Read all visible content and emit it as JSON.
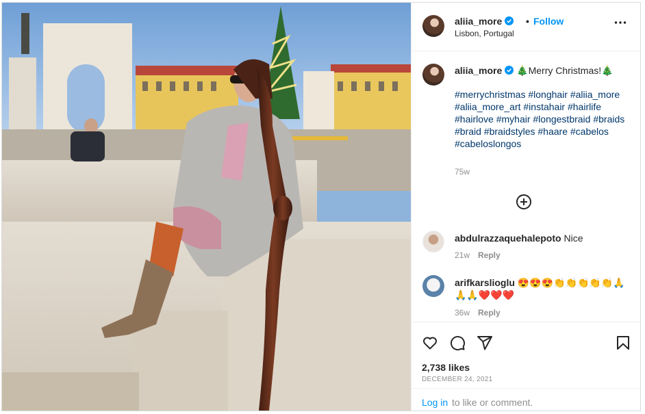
{
  "header": {
    "username": "aliia_more",
    "dot": "•",
    "follow_label": "Follow",
    "location": "Lisbon, Portugal"
  },
  "caption": {
    "username": "aliia_more",
    "text": "🎄Merry Christmas!🎄",
    "hashtags": "#merrychristmas #longhair #aliia_more #aliia_more_art #instahair #hairlife #hairlove #myhair #longestbraid #braids #braid #braidstyles #haare #cabelos #cabeloslongos",
    "time": "75w"
  },
  "comments": [
    {
      "username": "abdulrazzaquehalepoto",
      "text": "Nice",
      "time": "21w",
      "reply_label": "Reply"
    },
    {
      "username": "arifkarslioglu",
      "text": "😍😍😍👏👏👏👏👏🙏🙏🙏❤️❤️❤️",
      "time": "36w",
      "reply_label": "Reply"
    }
  ],
  "actions": {
    "likes": "2,738 likes",
    "date": "DECEMBER 24, 2021",
    "login_link": "Log in",
    "login_rest": "to like or comment."
  },
  "icons": {
    "verified": "verified-badge-icon",
    "more": "more-options-icon",
    "load_more": "plus-circle-icon",
    "like": "heart-icon",
    "comment": "comment-icon",
    "share": "paper-plane-icon",
    "save": "bookmark-icon"
  },
  "colors": {
    "link_blue": "#0095f6",
    "hashtag_blue": "#00376b",
    "muted": "#8e8e8e"
  }
}
